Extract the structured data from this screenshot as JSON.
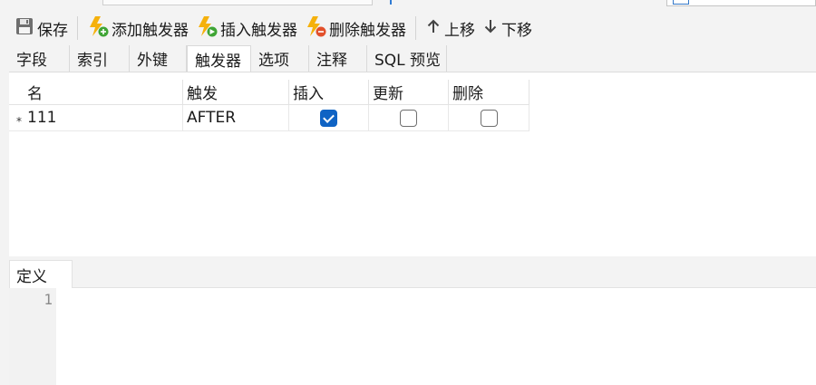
{
  "toolbar": {
    "save_label": "保存",
    "add_trigger_label": "添加触发器",
    "insert_trigger_label": "插入触发器",
    "delete_trigger_label": "删除触发器",
    "move_up_label": "上移",
    "move_down_label": "下移"
  },
  "tabs": [
    {
      "label": "字段"
    },
    {
      "label": "索引"
    },
    {
      "label": "外键"
    },
    {
      "label": "触发器",
      "active": true
    },
    {
      "label": "选项"
    },
    {
      "label": "注释"
    },
    {
      "label": "SQL 预览"
    }
  ],
  "grid": {
    "columns": [
      "名",
      "触发",
      "插入",
      "更新",
      "删除"
    ],
    "rows": [
      {
        "marker": "*",
        "name": "111",
        "timing": "AFTER",
        "insert": true,
        "update": false,
        "delete": false
      }
    ]
  },
  "definition": {
    "tab_label": "定义",
    "line_numbers": [
      "1"
    ]
  },
  "colors": {
    "accent": "#0f63c4",
    "lightning": "#f5b10c",
    "add_badge": "#3fa535",
    "delete_badge": "#e2502b"
  }
}
